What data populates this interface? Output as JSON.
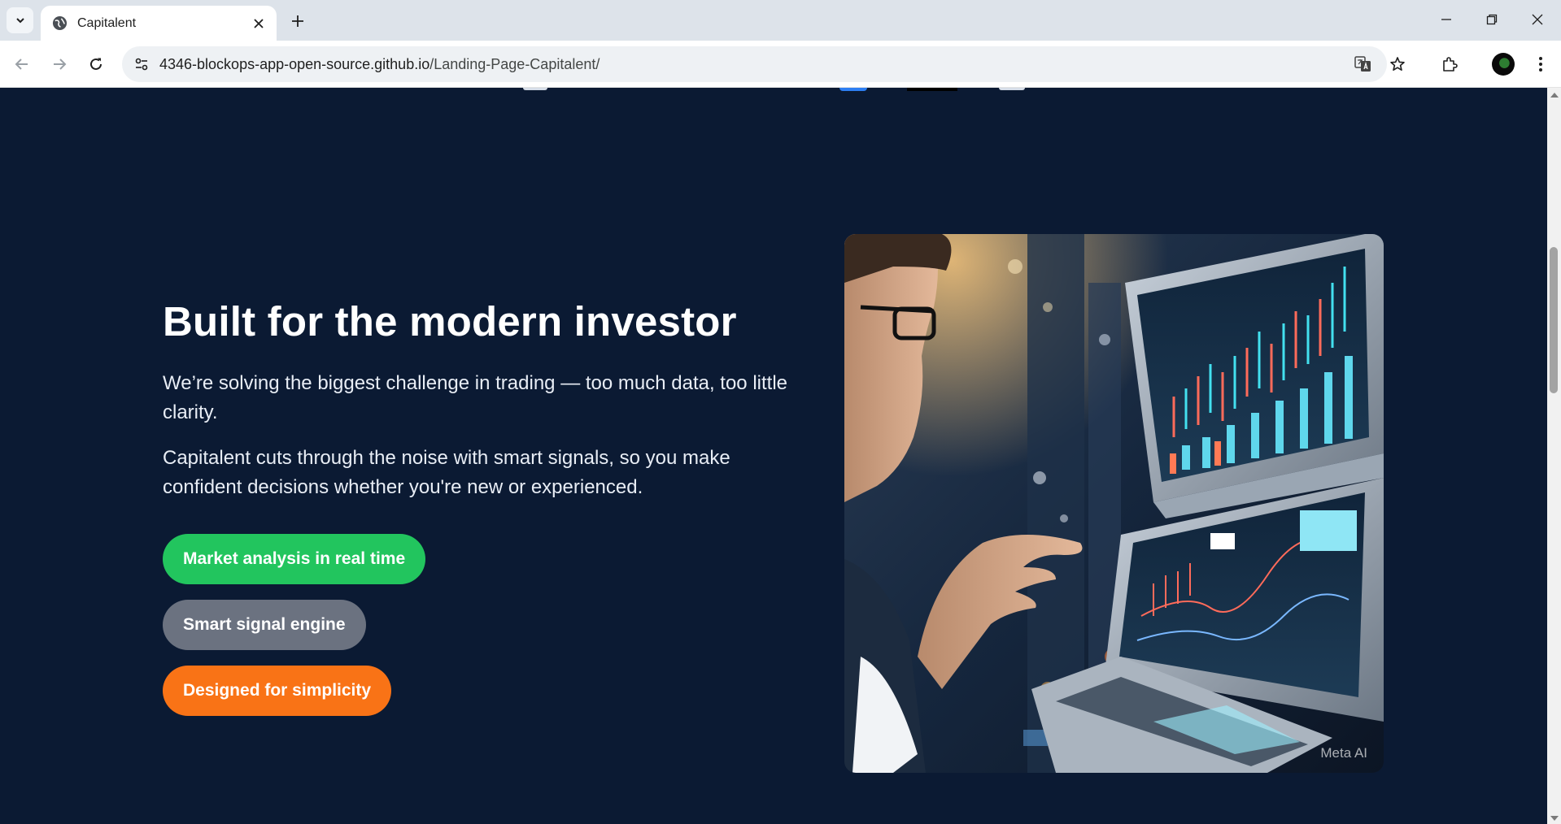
{
  "browser": {
    "tab_title": "Capitalent",
    "url_host": "4346-blockops-app-open-source.github.io",
    "url_path": "/Landing-Page-Capitalent/"
  },
  "section": {
    "headline": "Built for the modern investor",
    "paragraph1": "We’re solving the biggest challenge in trading — too much data, too little clarity.",
    "paragraph2": "Capitalent cuts through the noise with smart signals, so you make confident decisions whether you're new or experienced.",
    "features": [
      {
        "label": "Market analysis in real time",
        "color": "#22c55e"
      },
      {
        "label": "Smart signal engine",
        "color": "#6b7280"
      },
      {
        "label": "Designed for simplicity",
        "color": "#f97316"
      }
    ],
    "image_watermark": "Meta AI"
  },
  "colors": {
    "page_background": "#0b1a33",
    "accent_green": "#22c55e",
    "accent_orange": "#f97316"
  }
}
